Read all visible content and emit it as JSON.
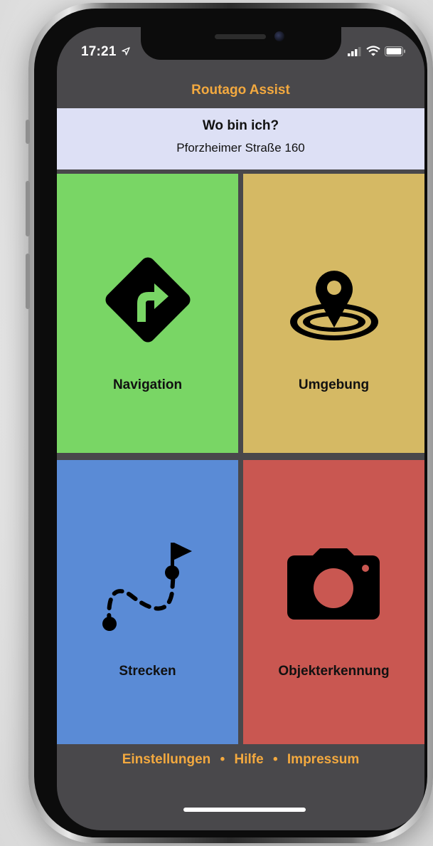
{
  "status_bar": {
    "time": "17:21"
  },
  "app": {
    "title": "Routago Assist"
  },
  "location": {
    "heading": "Wo bin ich?",
    "address": "Pforzheimer Straße 160"
  },
  "tiles": [
    {
      "label": "Navigation",
      "color": "#79d665",
      "icon": "turn-right-sign-icon"
    },
    {
      "label": "Umgebung",
      "color": "#d5b964",
      "icon": "location-pin-icon"
    },
    {
      "label": "Strecken",
      "color": "#5a8bd6",
      "icon": "route-flag-icon"
    },
    {
      "label": "Objekterkennung",
      "color": "#c95751",
      "icon": "camera-icon"
    }
  ],
  "footer": {
    "links": [
      "Einstellungen",
      "Hilfe",
      "Impressum"
    ],
    "separator": "•"
  },
  "colors": {
    "accent": "#f3a93f",
    "background": "#49484b",
    "location_bg": "#dde0f5"
  }
}
